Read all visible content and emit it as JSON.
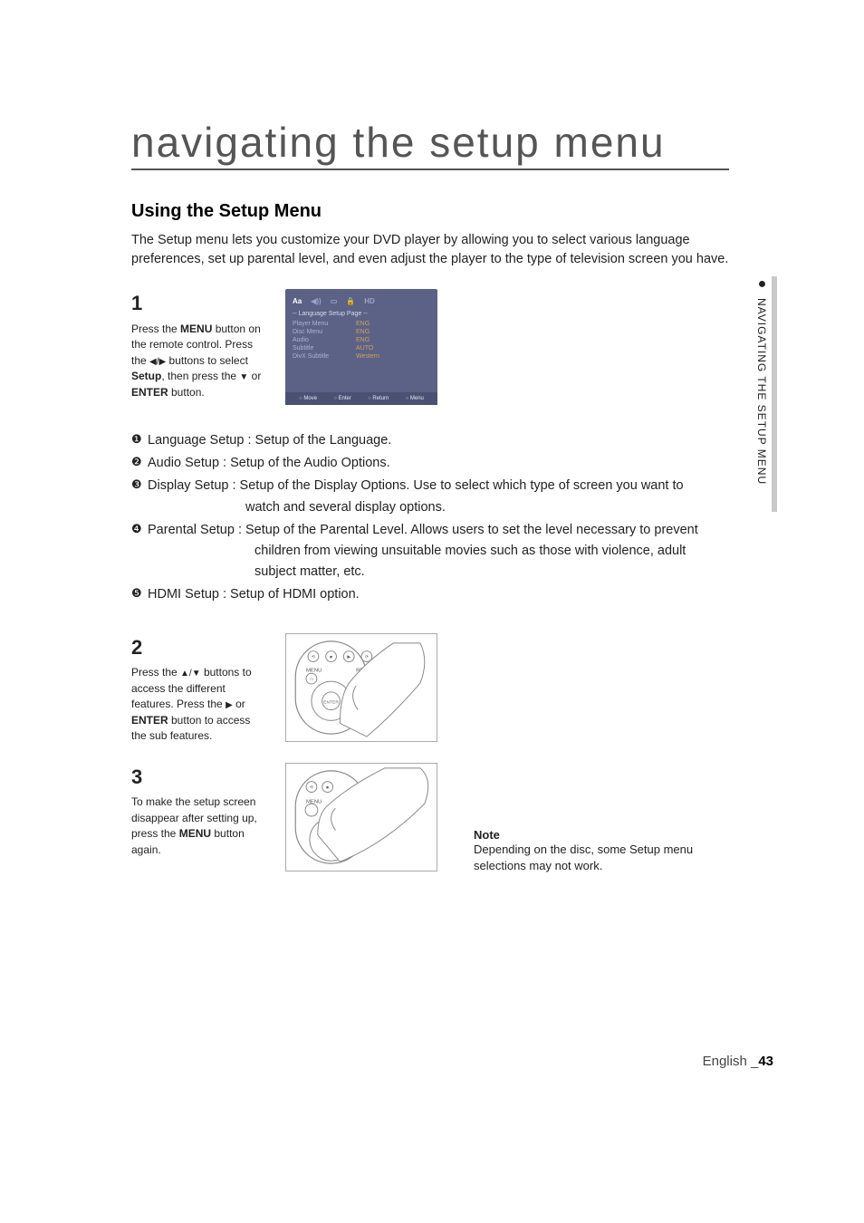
{
  "title": "navigating the setup menu",
  "section_heading": "Using the Setup Menu",
  "intro": "The Setup menu lets you customize your DVD player by allowing you to select various language preferences, set up parental level, and even adjust the player to the type of television screen you have.",
  "steps": {
    "s1": {
      "num": "1",
      "p1a": "Press the ",
      "p1b": "MENU",
      "p1c": " button on the remote control.",
      "p2a": "Press the ",
      "p2b": " buttons to select ",
      "p2c": "Setup",
      "p2d": ", then press the ",
      "p2e": " or ",
      "p2f": "ENTER",
      "p2g": " button."
    },
    "s2": {
      "num": "2",
      "p1a": "Press the ",
      "p1b": " buttons to access the different features. Press the ",
      "p1c": " or ",
      "p1d": "ENTER",
      "p1e": " button to access the sub features."
    },
    "s3": {
      "num": "3",
      "p1a": "To make the setup screen disappear after setting up, press the ",
      "p1b": "MENU",
      "p1c": " button again."
    }
  },
  "osd": {
    "tabs": {
      "aa": "Aa",
      "audio": "◀))",
      "display": "▭",
      "lock": "🔒",
      "hd": "HD"
    },
    "subtitle": "-- Language Setup Page --",
    "rows": [
      {
        "k": "Player Menu",
        "v": "ENG"
      },
      {
        "k": "Disc Menu",
        "v": "ENG"
      },
      {
        "k": "Audio",
        "v": "ENG"
      },
      {
        "k": "Subtitle",
        "v": "AUTO"
      },
      {
        "k": "DivX Subtitle",
        "v": "Western"
      }
    ],
    "foot": {
      "move": "Move",
      "enter": "Enter",
      "ret": "Return",
      "menu": "Menu"
    }
  },
  "enum": [
    {
      "mark": "❶",
      "lead": "Language Setup : Setup of the Language."
    },
    {
      "mark": "❷",
      "lead": "Audio Setup : Setup of the Audio Options."
    },
    {
      "mark": "❸",
      "lead": "Display Setup : Setup of the Display Options. Use to select which type of screen you want to",
      "cont": "watch and several display options."
    },
    {
      "mark": "❹",
      "lead": "Parental Setup : Setup of the Parental Level. Allows users to set the level necessary to prevent",
      "cont": "children from viewing unsuitable movies such as those with violence, adult subject matter, etc."
    },
    {
      "mark": "❺",
      "lead": "HDMI Setup : Setup of HDMI option."
    }
  ],
  "note": {
    "h": "Note",
    "t": "Depending on the disc, some Setup menu selections may not work."
  },
  "side": {
    "label": "NAVIGATING THE SETUP MENU"
  },
  "footer": {
    "lang": "English _",
    "page": "43"
  },
  "glyph": {
    "lr": "◀/▶",
    "ud": "▲/▼",
    "down": "▼",
    "right": "▶"
  }
}
